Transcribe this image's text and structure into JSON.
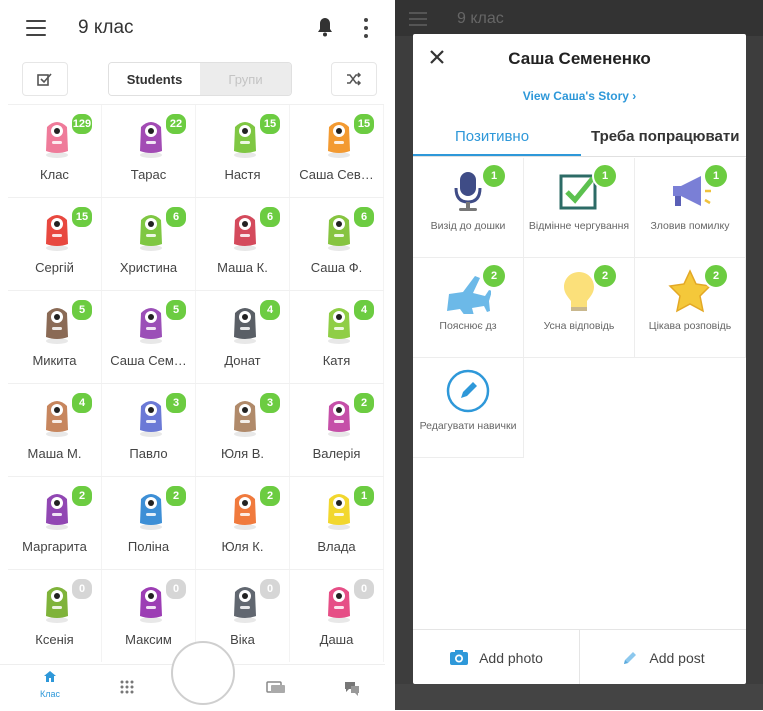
{
  "left": {
    "header": {
      "title": "9 клас"
    },
    "segment": {
      "students": "Students",
      "groups": "Групи"
    },
    "students": [
      {
        "name": "Клас",
        "points": "129",
        "color": "#ef7b9a"
      },
      {
        "name": "Тарас",
        "points": "22",
        "color": "#a24bb4"
      },
      {
        "name": "Настя",
        "points": "15",
        "color": "#7fc743"
      },
      {
        "name": "Саша Сев…",
        "points": "15",
        "color": "#f39a31"
      },
      {
        "name": "Сергій",
        "points": "15",
        "color": "#e8483f"
      },
      {
        "name": "Христина",
        "points": "6",
        "color": "#7fc743"
      },
      {
        "name": "Маша К.",
        "points": "6",
        "color": "#d44a5c"
      },
      {
        "name": "Саша Ф.",
        "points": "6",
        "color": "#86c440"
      },
      {
        "name": "Микита",
        "points": "5",
        "color": "#8a6a55"
      },
      {
        "name": "Саша Сем…",
        "points": "5",
        "color": "#9b4fb7"
      },
      {
        "name": "Донат",
        "points": "4",
        "color": "#5a5f66"
      },
      {
        "name": "Катя",
        "points": "4",
        "color": "#8fce46"
      },
      {
        "name": "Маша М.",
        "points": "4",
        "color": "#c7865e"
      },
      {
        "name": "Павло",
        "points": "3",
        "color": "#6b79d6"
      },
      {
        "name": "Юля В.",
        "points": "3",
        "color": "#b08a6a"
      },
      {
        "name": "Валерія",
        "points": "2",
        "color": "#c54fa8"
      },
      {
        "name": "Маргарита",
        "points": "2",
        "color": "#9147b3"
      },
      {
        "name": "Поліна",
        "points": "2",
        "color": "#3d8fd6"
      },
      {
        "name": "Юля К.",
        "points": "2",
        "color": "#f07a3d"
      },
      {
        "name": "Влада",
        "points": "1",
        "color": "#f2d72e"
      },
      {
        "name": "Ксенія",
        "points": "0",
        "color": "#7fb33a"
      },
      {
        "name": "Максим",
        "points": "0",
        "color": "#9c3db4"
      },
      {
        "name": "Віка",
        "points": "0",
        "color": "#616770"
      },
      {
        "name": "Даша",
        "points": "0",
        "color": "#e64e86"
      }
    ],
    "nav": {
      "home_label": "Клас"
    }
  },
  "right": {
    "bg_title": "9 клас",
    "modal": {
      "title": "Саша Семененко",
      "story_link": "View Саша's Story ›",
      "tab_positive": "Позитивно",
      "tab_negative": "Треба попрацювати",
      "skills": [
        {
          "label": "Визід до дошки",
          "points": "1",
          "icon": "microphone-icon"
        },
        {
          "label": "Відмінне чергування",
          "points": "1",
          "icon": "checkbox-icon"
        },
        {
          "label": "Зловив помилку",
          "points": "1",
          "icon": "megaphone-icon"
        },
        {
          "label": "Пояснює дз",
          "points": "2",
          "icon": "airplane-icon"
        },
        {
          "label": "Усна відповідь",
          "points": "2",
          "icon": "lightbulb-icon"
        },
        {
          "label": "Цікава розповідь",
          "points": "2",
          "icon": "star-icon"
        },
        {
          "label": "Редагувати навички",
          "points": "",
          "icon": "edit-icon"
        }
      ],
      "add_photo": "Add photo",
      "add_post": "Add post"
    }
  },
  "colors": {
    "accent": "#2e98d9",
    "badge": "#6ccc41",
    "badge_zero": "#d6d6d6"
  }
}
